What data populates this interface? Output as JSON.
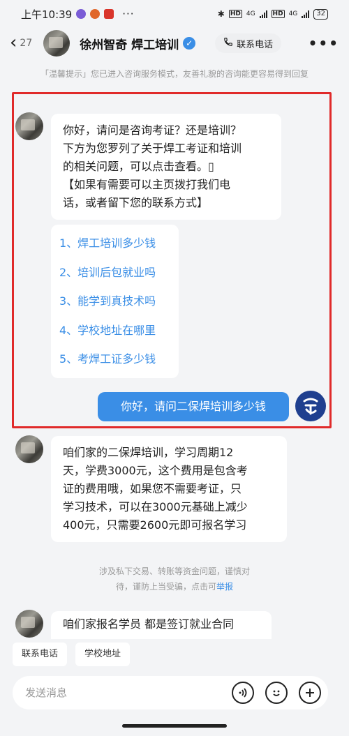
{
  "status_bar": {
    "time": "上午10:39",
    "more": "···",
    "net1": "4G",
    "net2": "4G",
    "hd": "HD",
    "battery": "32"
  },
  "header": {
    "back_count": "27",
    "title": "徐州智奇 焊工培训",
    "contact_label": "联系电话"
  },
  "tip": "「温馨提示」您已进入咨询服务模式，友善礼貌的咨询能更容易得到回复",
  "messages": {
    "greeting": {
      "lines": [
        "你好，请问是咨询考证？还是培训？",
        "下方为您罗列了关于焊工考证和培训",
        "的相关问题，可以点击查看。▯",
        "【如果有需要可以主页拨打我们电",
        "话，或者留下您的联系方式】"
      ]
    },
    "options": [
      "1、焊工培训多少钱",
      "2、培训后包就业吗",
      "3、能学到真技术吗",
      "4、学校地址在哪里",
      "5、考焊工证多少钱"
    ],
    "user_question": "你好，请问二保焊培训多少钱",
    "reply": {
      "lines": [
        "咱们家的二保焊培训，学习周期12",
        "天，学费3000元，这个费用是包含考",
        "证的费用哦，如果您不需要考证，只",
        "学习技术，可以在3000元基础上减少",
        "400元，只需要2600元即可报名学习"
      ]
    },
    "notice": {
      "line1": "涉及私下交易、转账等资金问题，谨慎对",
      "line2": "待，谨防上当受骗，点击可",
      "report": "举报"
    },
    "last": "咱们家报名学员 都是签订就业合同"
  },
  "quick_replies": [
    "联系电话",
    "学校地址"
  ],
  "input": {
    "placeholder": "发送消息"
  },
  "colors": {
    "accent": "#3a8ee6",
    "highlight_border": "#e02a2a",
    "background": "#f3f4f6"
  }
}
